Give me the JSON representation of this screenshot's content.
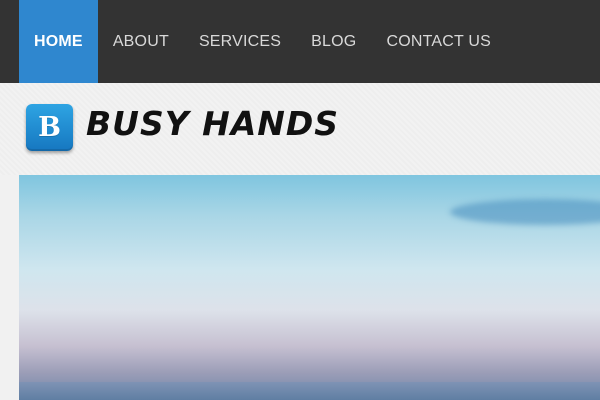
{
  "nav": {
    "items": [
      {
        "label": "HOME",
        "active": true
      },
      {
        "label": "ABOUT",
        "active": false
      },
      {
        "label": "SERVICES",
        "active": false
      },
      {
        "label": "BLOG",
        "active": false
      },
      {
        "label": "CONTACT US",
        "active": false
      }
    ],
    "colors": {
      "background": "#333333",
      "active_background": "#2f87cf",
      "text": "#d9d9d9",
      "active_text": "#ffffff"
    }
  },
  "brand": {
    "logo_letter": "B",
    "name": "BUSY HANDS",
    "logo_color": "#2b8fd6"
  },
  "hero": {
    "image_description": "sky-and-horizon-banner"
  }
}
